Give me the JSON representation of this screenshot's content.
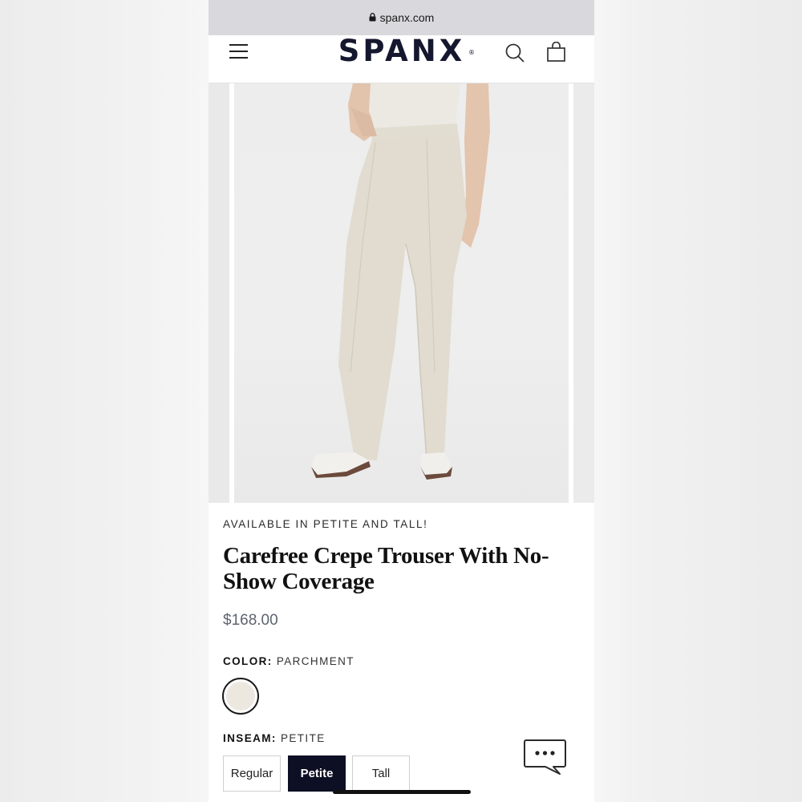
{
  "browser": {
    "url": "spanx.com"
  },
  "header": {
    "logo": "SPANX",
    "logo_mark": "®",
    "menu_icon": "hamburger-menu-icon",
    "search_icon": "search-icon",
    "cart_icon": "shopping-bag-icon"
  },
  "product": {
    "eyebrow": "AVAILABLE IN PETITE AND TALL!",
    "title": "Carefree Crepe Trouser With No-Show Coverage",
    "price": "$168.00",
    "color_label": "COLOR:",
    "color_value": "PARCHMENT",
    "swatch_color": "#ece8e0",
    "inseam_label": "INSEAM:",
    "inseam_value": "PETITE",
    "inseam_options": [
      "Regular",
      "Petite",
      "Tall"
    ],
    "selected_inseam": "Petite"
  },
  "colors": {
    "brand_navy": "#14172e",
    "selected_button": "#0d0f24",
    "price_gray": "#5d6470"
  },
  "chat": {
    "icon": "chat-bubble-icon"
  }
}
